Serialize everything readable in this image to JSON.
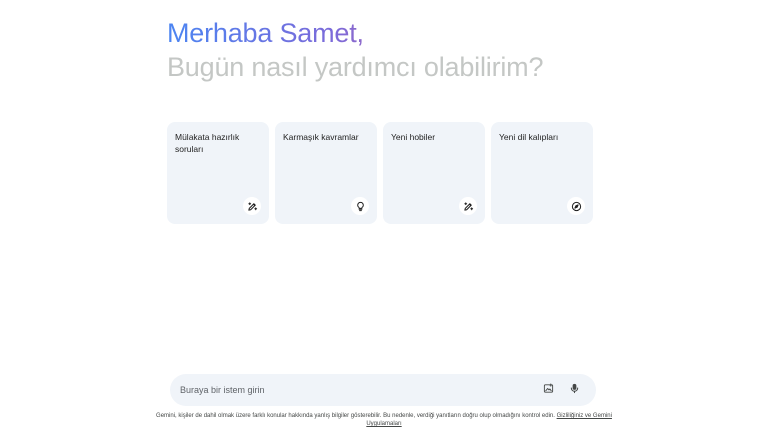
{
  "greeting": {
    "hello": "Merhaba Samet,",
    "subtitle": "Bugün nasıl yardımcı olabilirim?"
  },
  "cards": [
    {
      "label": "Mülakata hazırlık soruları",
      "icon": "edit-sparkle-icon"
    },
    {
      "label": "Karmaşık kavramlar",
      "icon": "lightbulb-icon"
    },
    {
      "label": "Yeni hobiler",
      "icon": "edit-sparkle-icon"
    },
    {
      "label": "Yeni dil kalıpları",
      "icon": "compass-icon"
    }
  ],
  "input": {
    "placeholder": "Buraya bir istem girin",
    "image_icon": "image-upload-icon",
    "mic_icon": "mic-icon"
  },
  "disclaimer": {
    "text": "Gemini, kişiler de dahil olmak üzere farklı konular hakkında yanlış bilgiler gösterebilir. Bu nedenle, verdiği yanıtların doğru olup olmadığını kontrol edin.",
    "link": "Gizliliğiniz ve Gemini Uygulamaları"
  },
  "colors": {
    "card_bg": "#f0f4f9",
    "subtitle": "#c4c7c5",
    "gradient_start": "#4b85f2",
    "gradient_end": "#d96570"
  }
}
